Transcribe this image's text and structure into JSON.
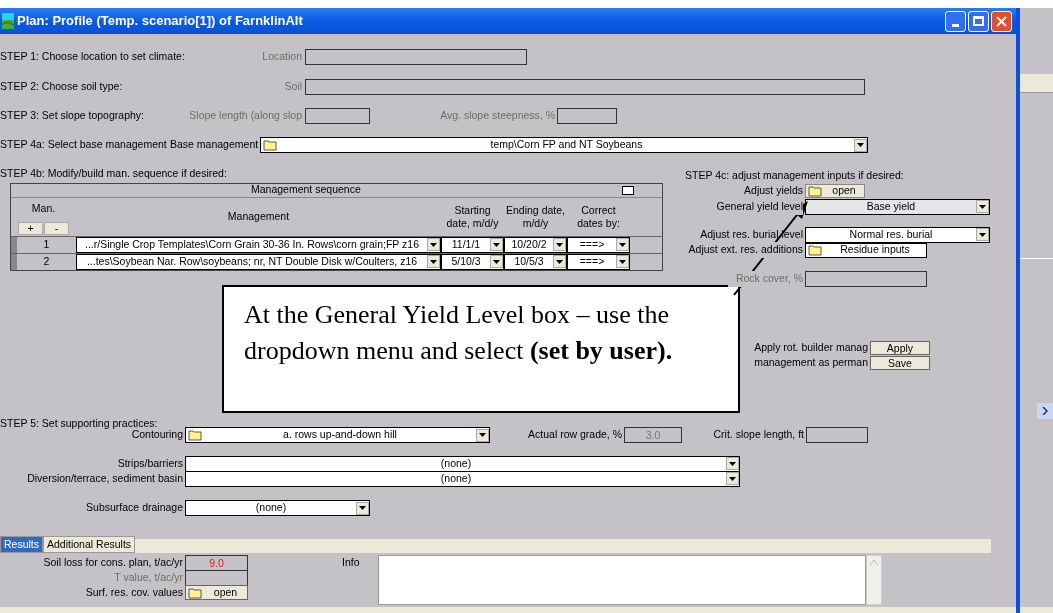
{
  "window": {
    "title": "Plan:  Profile (Temp. scenario[1]) of FarnklinAlt"
  },
  "step1": {
    "label": "STEP 1: Choose location to set climate:",
    "field_label": "Location"
  },
  "step2": {
    "label": "STEP 2: Choose soil type:",
    "field_label": "Soil"
  },
  "step3": {
    "label": "STEP 3: Set slope topography:",
    "slope_length_label": "Slope length (along slop",
    "steepness_label": "Avg. slope steepness, %"
  },
  "step4a": {
    "label": "STEP 4a: Select base management",
    "field_label": "Base management",
    "value": "temp\\Corn FP and NT Soybeans"
  },
  "step4b": {
    "label": "STEP 4b: Modify/build man. sequence if desired:",
    "panel_title": "Management sequence",
    "columns": [
      "Man.",
      "Management",
      "Starting date, m/d/y",
      "Ending date, m/d/y",
      "Correct dates by:"
    ],
    "add_button": "+",
    "remove_button": "-",
    "rows": [
      {
        "man": "1",
        "management": "...r/Single Crop Templates\\Corn Grain 30-36 In. Rows\\corn grain;FP z16",
        "start": "11/1/1",
        "end": "10/20/2",
        "correct": "===>"
      },
      {
        "man": "2",
        "management": "...tes\\Soybean Nar. Row\\soybeans; nr, NT Double Disk w/Coulters, z16",
        "start": "5/10/3",
        "end": "10/5/3",
        "correct": "===>"
      }
    ]
  },
  "step4c": {
    "label": "STEP 4c: adjust management inputs if desired:",
    "adjust_yields_label": "Adjust yields",
    "adjust_yields_button": "open",
    "yield_level_label": "General yield level",
    "yield_level": "Base yield",
    "burial_label": "Adjust res. burial level",
    "burial": "Normal res. burial",
    "additions_label": "Adjust ext. res. additions",
    "additions_button": "Residue inputs",
    "rock_cover_label": "Rock cover, %",
    "apply_label": "Apply rot. builder manag",
    "apply_button": "Apply",
    "save_label": "management as perman",
    "save_button": "Save"
  },
  "step5": {
    "label": "STEP 5: Set supporting practices:",
    "contouring_label": "Contouring",
    "contouring": "a. rows up-and-down hill",
    "row_grade_label": "Actual row grade, %",
    "row_grade": "3.0",
    "crit_length_label": "Crit. slope length, ft",
    "strips_label": "Strips/barriers",
    "strips": "(none)",
    "diversion_label": "Diversion/terrace, sediment basin",
    "diversion": "(none)",
    "drainage_label": "Subsurface drainage",
    "drainage": "(none)"
  },
  "tabs": [
    {
      "label": "Results",
      "selected": true
    },
    {
      "label": "Additional Results",
      "selected": false
    }
  ],
  "results": {
    "soil_loss_label": "Soil loss for cons. plan, t/ac/yr",
    "soil_loss": "9.0",
    "t_value_label": "T value, t/ac/yr",
    "surf_res_label": "Surf. res. cov. values",
    "surf_res_button": "open",
    "info_label": "Info"
  },
  "callout": {
    "text": "At the General Yield Level box – use the dropdown menu and select **(set by user).**"
  }
}
